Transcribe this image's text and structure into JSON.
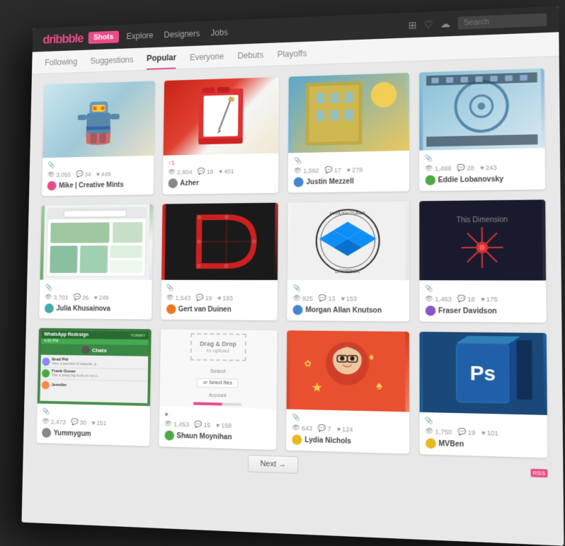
{
  "nav": {
    "logo": "dribbble",
    "shots_label": "Shots",
    "links": [
      "Explore",
      "Designers",
      "Jobs"
    ],
    "search_placeholder": "Search"
  },
  "subnav": {
    "items": [
      {
        "label": "Following",
        "active": false
      },
      {
        "label": "Suggestions",
        "active": false
      },
      {
        "label": "Popular",
        "active": true
      },
      {
        "label": "Everyone",
        "active": false
      },
      {
        "label": "Debuts",
        "active": false
      },
      {
        "label": "Playoffs",
        "active": false
      }
    ]
  },
  "shots": [
    {
      "id": "1",
      "image_type": "robot",
      "views": "3,050",
      "comments": "34",
      "likes": "449",
      "author": "Mike | Creative Mints",
      "avatar_color": "pink"
    },
    {
      "id": "2",
      "image_type": "notebook",
      "views": "2,804",
      "comments": "18",
      "likes": "401",
      "author": "Azher",
      "avatar_color": "gray"
    },
    {
      "id": "3",
      "image_type": "building",
      "views": "1,592",
      "comments": "17",
      "likes": "278",
      "author": "Justin Mezzell",
      "avatar_color": "blue"
    },
    {
      "id": "4",
      "image_type": "film",
      "views": "1,488",
      "comments": "28",
      "likes": "243",
      "author": "Eddie Lobanovsky",
      "avatar_color": "green"
    },
    {
      "id": "5",
      "image_type": "website",
      "views": "3,701",
      "comments": "26",
      "likes": "249",
      "author": "Julia Khusainova",
      "avatar_color": "teal"
    },
    {
      "id": "6",
      "image_type": "logo-d",
      "views": "1,543",
      "comments": "19",
      "likes": "193",
      "author": "Gert van Duinen",
      "avatar_color": "orange"
    },
    {
      "id": "7",
      "image_type": "dropbox",
      "views": "925",
      "comments": "13",
      "likes": "153",
      "author": "Morgan Allan Knutson",
      "avatar_color": "blue"
    },
    {
      "id": "8",
      "image_type": "dark-star",
      "views": "1,463",
      "comments": "18",
      "likes": "175",
      "author": "Fraser Davidson",
      "avatar_color": "purple"
    },
    {
      "id": "9",
      "image_type": "whatsapp",
      "views": "2,473",
      "comments": "30",
      "likes": "151",
      "author": "Yummygum",
      "avatar_color": "gray"
    },
    {
      "id": "10",
      "image_type": "upload",
      "views": "1,453",
      "comments": "15",
      "likes": "158",
      "author": "Shaun Moynihan",
      "avatar_color": "green"
    },
    {
      "id": "11",
      "image_type": "girl",
      "views": "643",
      "comments": "7",
      "likes": "124",
      "author": "Lydia Nichols",
      "avatar_color": "yellow"
    },
    {
      "id": "12",
      "image_type": "photoshop",
      "views": "1,750",
      "comments": "19",
      "likes": "101",
      "author": "MVBen",
      "avatar_color": "yellow"
    }
  ],
  "next_button": "Next →",
  "rss_label": "RSS"
}
